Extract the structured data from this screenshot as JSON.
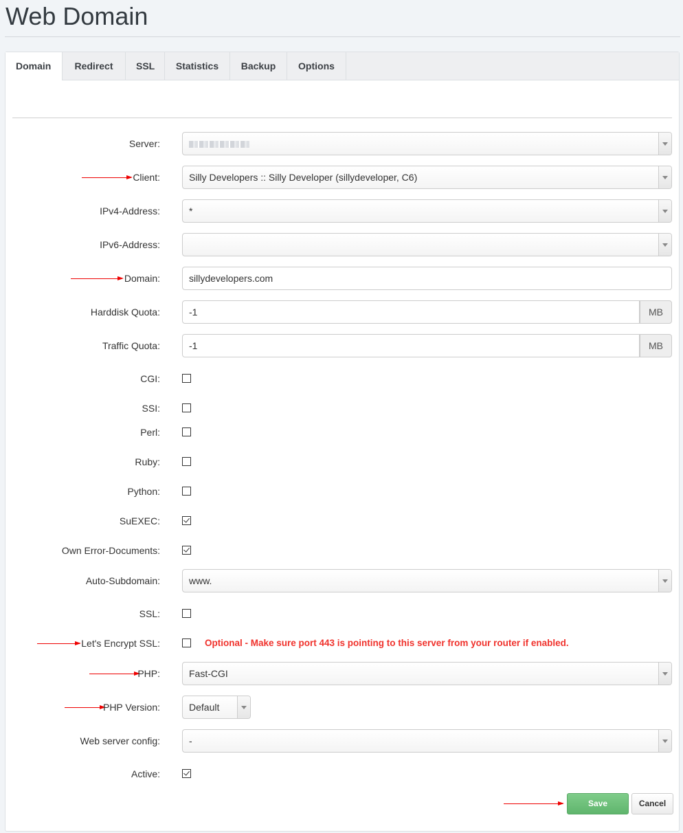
{
  "page": {
    "title": "Web Domain"
  },
  "tabs": [
    {
      "label": "Domain",
      "active": true
    },
    {
      "label": "Redirect"
    },
    {
      "label": "SSL"
    },
    {
      "label": "Statistics"
    },
    {
      "label": "Backup"
    },
    {
      "label": "Options"
    }
  ],
  "form": {
    "server": {
      "label": "Server:",
      "value": "[blurred]"
    },
    "client": {
      "label": "Client:",
      "value": "Silly Developers :: Silly Developer (sillydeveloper, C6)"
    },
    "ipv4": {
      "label": "IPv4-Address:",
      "value": "*"
    },
    "ipv6": {
      "label": "IPv6-Address:",
      "value": ""
    },
    "domain": {
      "label": "Domain:",
      "value": "sillydevelopers.com"
    },
    "harddisk_quota": {
      "label": "Harddisk Quota:",
      "value": "-1",
      "unit": "MB"
    },
    "traffic_quota": {
      "label": "Traffic Quota:",
      "value": "-1",
      "unit": "MB"
    },
    "cgi": {
      "label": "CGI:",
      "checked": false
    },
    "ssi": {
      "label": "SSI:",
      "checked": false
    },
    "perl": {
      "label": "Perl:",
      "checked": false
    },
    "ruby": {
      "label": "Ruby:",
      "checked": false
    },
    "python": {
      "label": "Python:",
      "checked": false
    },
    "suexec": {
      "label": "SuEXEC:",
      "checked": true
    },
    "own_error_documents": {
      "label": "Own Error-Documents:",
      "checked": true
    },
    "auto_subdomain": {
      "label": "Auto-Subdomain:",
      "value": "www."
    },
    "ssl": {
      "label": "SSL:",
      "checked": false
    },
    "lets_encrypt": {
      "label": "Let's Encrypt SSL:",
      "checked": false,
      "note": "Optional - Make sure port 443 is pointing to this server from your router if enabled."
    },
    "php": {
      "label": "PHP:",
      "value": "Fast-CGI"
    },
    "php_version": {
      "label": "PHP Version:",
      "value": "Default"
    },
    "web_server_config": {
      "label": "Web server config:",
      "value": "-"
    },
    "active": {
      "label": "Active:",
      "checked": true
    }
  },
  "buttons": {
    "save": "Save",
    "cancel": "Cancel"
  },
  "colors": {
    "annotation_arrow": "#e00000",
    "note_text": "#f0312b",
    "save_button": "#6cbf79"
  }
}
